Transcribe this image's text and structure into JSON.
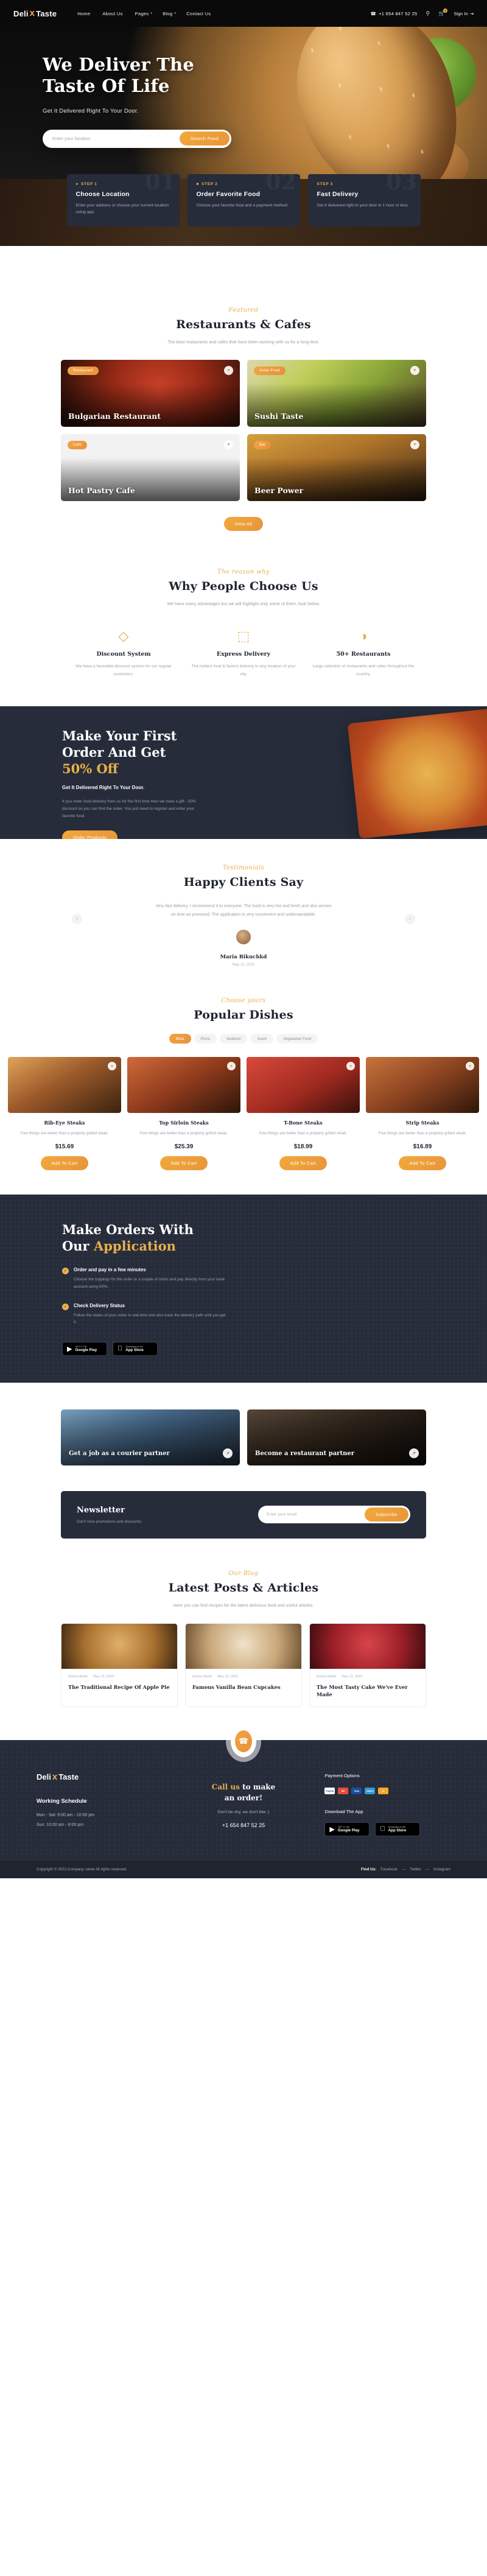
{
  "brand": {
    "name_a": "Deli",
    "name_b": "Taste",
    "flame": "flame-icon"
  },
  "header": {
    "nav": [
      {
        "label": "Home",
        "caret": ""
      },
      {
        "label": "About Us",
        "caret": ""
      },
      {
        "label": "Pages",
        "caret": "▾"
      },
      {
        "label": "Blog",
        "caret": "▾"
      },
      {
        "label": "Contact Us",
        "caret": ""
      }
    ],
    "phone": "+1 654 847 52 25",
    "cart_count": "0",
    "signin": "Sign In"
  },
  "hero": {
    "title_line1": "We Deliver The",
    "title_line2": "Taste Of Life",
    "subtitle": "Get It Delivered Right To Your Door.",
    "search_placeholder": "Enter your location",
    "search_value": "",
    "search_button": "Search Food"
  },
  "steps": [
    {
      "num": "01",
      "tag": "STEP 1",
      "title": "Choose Location",
      "desc": "Enter your address or choose your current location using app."
    },
    {
      "num": "02",
      "tag": "STEP 2",
      "title": "Order Favorite Food",
      "desc": "Choose your favorite food and a payment method."
    },
    {
      "num": "03",
      "tag": "STEP 3",
      "title": "Fast Delivery",
      "desc": "Get it delivered right to your door in 1 hour or less."
    }
  ],
  "restaurants": {
    "eyebrow": "Featured",
    "title": "Restaurants & Cafes",
    "desc": "The best restaurants and cafes that have been working with us for a long time.",
    "cards": [
      {
        "tag": "Restaurant",
        "name": "Bulgarian Restaurant"
      },
      {
        "tag": "Asian Food",
        "name": "Sushi Taste"
      },
      {
        "tag": "Cafe",
        "name": "Hot Pastry Cafe"
      },
      {
        "tag": "Bar",
        "name": "Beer Power"
      }
    ],
    "button": "View All"
  },
  "why": {
    "eyebrow": "The reason why",
    "title": "Why People Choose Us",
    "desc": "We have many advantages but we will highlight only some of them, look below.",
    "features": [
      {
        "icon": "discount-tag-icon",
        "glyph": "◇",
        "title": "Discount System",
        "desc": "We have a favorable discount system for our regular customers."
      },
      {
        "icon": "delivery-truck-icon",
        "glyph": "⬚",
        "title": "Express Delivery",
        "desc": "The hottest food & fastest delivery to any location of your city."
      },
      {
        "icon": "serving-dish-icon",
        "glyph": "◑",
        "title": "50+ Restaurants",
        "desc": "Large selection of restaurants and cafes throughout the country."
      }
    ]
  },
  "promo": {
    "line1": "Make Your First",
    "line2": "Order And Get",
    "line3": "50% Off",
    "sub": "Get It Delivered Right To Your Door.",
    "body": "If you order food delivery from us for the first time then we have a gift - 50% discount so you can find the order. You just need to register and enter your favorite food.",
    "button": "Order Products"
  },
  "testimonial": {
    "eyebrow": "Testimonials",
    "title": "Happy Clients Say",
    "quote": "Very fast delivery. I recommend it to everyone. The food is very hot and fresh and also arrives on time as promised. The application is very convenient and understandable.",
    "name": "Maria Bikuchkd",
    "date": "May 13, 2022",
    "prev": "‹",
    "next": "›"
  },
  "dishes": {
    "eyebrow": "Choose yours",
    "title": "Popular Dishes",
    "tabs": [
      {
        "label": "Meat",
        "active": true
      },
      {
        "label": "Pizza",
        "active": false
      },
      {
        "label": "Seafood",
        "active": false
      },
      {
        "label": "Sushi",
        "active": false
      },
      {
        "label": "Vegetarian Food",
        "active": false
      }
    ],
    "items": [
      {
        "name": "Rib-Eye Steaks",
        "desc": "Few things are better than a properly grilled steak.",
        "price": "$15.69",
        "button": "Add To Cart"
      },
      {
        "name": "Top Sirloin Steaks",
        "desc": "Few things are better than a properly grilled steak.",
        "price": "$25.39",
        "button": "Add To Cart"
      },
      {
        "name": "T-Bone Steaks",
        "desc": "Few things are better than a properly grilled steak.",
        "price": "$18.99",
        "button": "Add To Cart"
      },
      {
        "name": "Strip Steaks",
        "desc": "Few things are better than a properly grilled steak.",
        "price": "$16.89",
        "button": "Add To Cart"
      }
    ]
  },
  "app": {
    "line1": "Make Orders With",
    "line2_a": "Our ",
    "line2_b": "Application",
    "items": [
      {
        "title": "Order and pay in a few minutes",
        "desc": "Choose the toppings for the order or a couple of clicks and pay directly from your bank account using GPA."
      },
      {
        "title": "Check Delivery Status",
        "desc": "Follow the status of your order in real time and also track the delivery path until you get it."
      }
    ],
    "stores": [
      {
        "small": "GET IT ON",
        "big": "Google Play",
        "icon": "google-play-icon"
      },
      {
        "small": "Download on the",
        "big": "App Store",
        "icon": "apple-icon"
      }
    ]
  },
  "partner": {
    "cards": [
      {
        "title": "Get a job as a courier partner",
        "arrow": "↗"
      },
      {
        "title": "Become a restaurant partner",
        "arrow": "↗"
      }
    ]
  },
  "newsletter": {
    "title": "Newsletter",
    "desc": "Don't miss promotions and discounts.",
    "placeholder": "Enter your email",
    "value": "",
    "button": "Subscribe"
  },
  "blog": {
    "eyebrow": "Our Blog",
    "title": "Latest Posts & Articles",
    "desc": "Here you can find recipes for the latest delicious food and useful articles.",
    "posts": [
      {
        "author": "Dorina Wolfe",
        "date": "May 13, 2022",
        "title": "The Traditional Recipe Of Apple Pie"
      },
      {
        "author": "Dorina Wolfe",
        "date": "May 13, 2022",
        "title": "Famous Vanilla Bean Cupcakes"
      },
      {
        "author": "Dorina Wolfe",
        "date": "May 13, 2022",
        "title": "The Most Tasty Cake We've Ever Made"
      }
    ]
  },
  "footer": {
    "schedule_title": "Working Schedule",
    "schedule_1": "Mon - Sat: 9:00 am - 10:00 pm",
    "schedule_2": "Sun: 10:00 am - 8:00 pm",
    "call_a": "Call us",
    "call_b": " to make",
    "call_c": "an order!",
    "shy": "Don't be shy, we don't bite :)",
    "phone": "+1 654 847 52 25",
    "pay_title": "Payment Options",
    "pays": [
      {
        "label": "PayPal",
        "color": "#ffffff"
      },
      {
        "label": "MC",
        "color": "#eb4b3c"
      },
      {
        "label": "Visa",
        "color": "#1a4fa0"
      },
      {
        "label": "AMEX",
        "color": "#2e9bd6"
      },
      {
        "label": "D",
        "color": "#f0a92c"
      }
    ],
    "app_title": "Download The App",
    "copyright": "Copyright © 2022.Company name All rights reserved.",
    "findus": "Find Us:",
    "socials": [
      "Facebook",
      "Twitter",
      "Instagram"
    ]
  }
}
